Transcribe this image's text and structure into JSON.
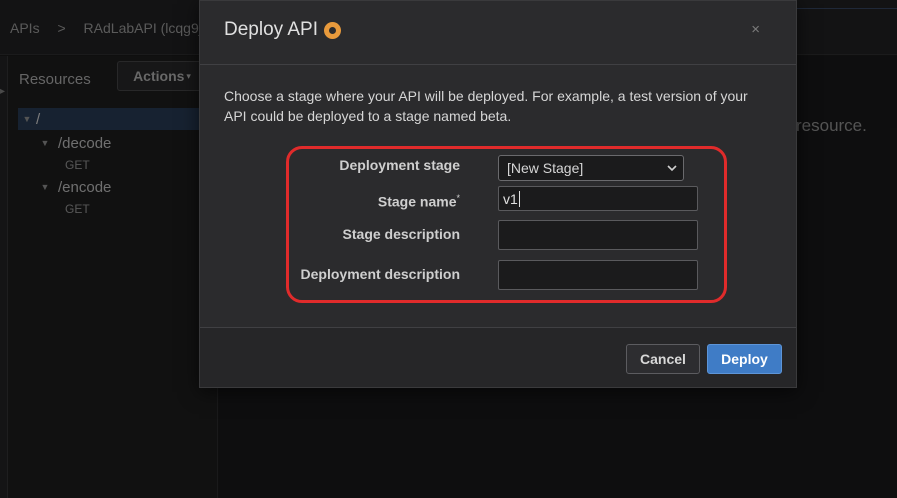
{
  "breadcrumb": {
    "apis": "APIs",
    "separator": ">",
    "current": "RAdLabAPI (lcqg9j"
  },
  "resources_panel": {
    "title": "Resources",
    "actions_label": "Actions",
    "tree": [
      {
        "label": "/",
        "kind": "resource"
      },
      {
        "label": "/decode",
        "kind": "resource"
      },
      {
        "label": "GET",
        "kind": "method"
      },
      {
        "label": "/encode",
        "kind": "resource"
      },
      {
        "label": "GET",
        "kind": "method"
      }
    ]
  },
  "background": {
    "partial_text": "resource."
  },
  "modal": {
    "title": "Deploy API",
    "close_glyph": "×",
    "intro": "Choose a stage where your API will be deployed. For example, a test version of your API could be deployed to a stage named beta.",
    "form": {
      "deployment_stage_label": "Deployment stage",
      "deployment_stage_value": "[New Stage]",
      "stage_name_label": "Stage name",
      "stage_name_required_mark": "*",
      "stage_name_value": "v1",
      "stage_description_label": "Stage description",
      "stage_description_value": "",
      "deployment_description_label": "Deployment description",
      "deployment_description_value": ""
    },
    "cancel_label": "Cancel",
    "deploy_label": "Deploy"
  },
  "colors": {
    "highlight_border": "#e02b2b",
    "primary_button": "#3f7cc6",
    "info_icon": "#e89a3c",
    "selected_row": "#2b3f5a"
  }
}
